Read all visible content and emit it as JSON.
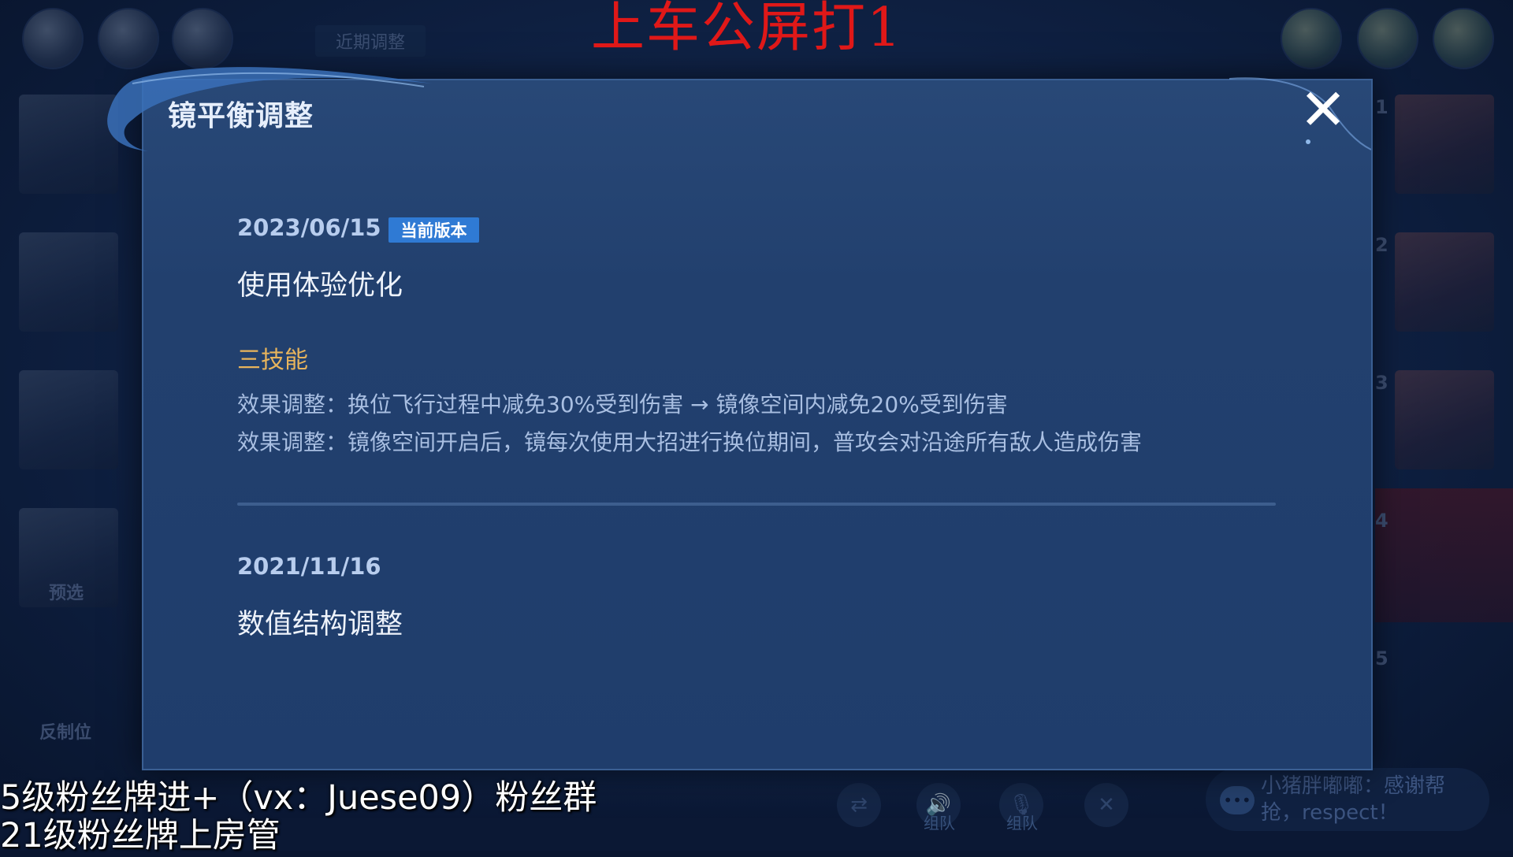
{
  "stream_overlay": {
    "title": "上车公屏打1",
    "caption_line1": "5级粉丝牌进+（vx：Juese09）粉丝群",
    "caption_line2": "21级粉丝牌上房管"
  },
  "lobby": {
    "recent_tab": "近期调整",
    "left_labels": [
      "预选",
      "反制位"
    ],
    "right_slot_numbers": [
      "1",
      "2",
      "3",
      "4",
      "5"
    ],
    "bottom_bar": {
      "team_voice_label": "组队",
      "team_mic_label": "组队",
      "chat_text": "小猪胖嘟嘟：感谢帮抢，respect！"
    }
  },
  "dialog": {
    "title": "镜平衡调整",
    "close_icon": "close-icon",
    "entries": [
      {
        "date": "2023/06/15",
        "badge": "当前版本",
        "title": "使用体验优化",
        "skill": "三技能",
        "effects": [
          "效果调整：换位飞行过程中减免30%受到伤害 → 镜像空间内减免20%受到伤害",
          "效果调整：镜像空间开启后，镜每次使用大招进行换位期间，普攻会对沿途所有敌人造成伤害"
        ]
      },
      {
        "date": "2021/11/16",
        "title": "数值结构调整"
      }
    ]
  },
  "colors": {
    "dialog_bg": "#22406e",
    "badge_bg": "#2f7ad4",
    "skill_name": "#e8b45c",
    "overlay_title": "#e01818"
  }
}
